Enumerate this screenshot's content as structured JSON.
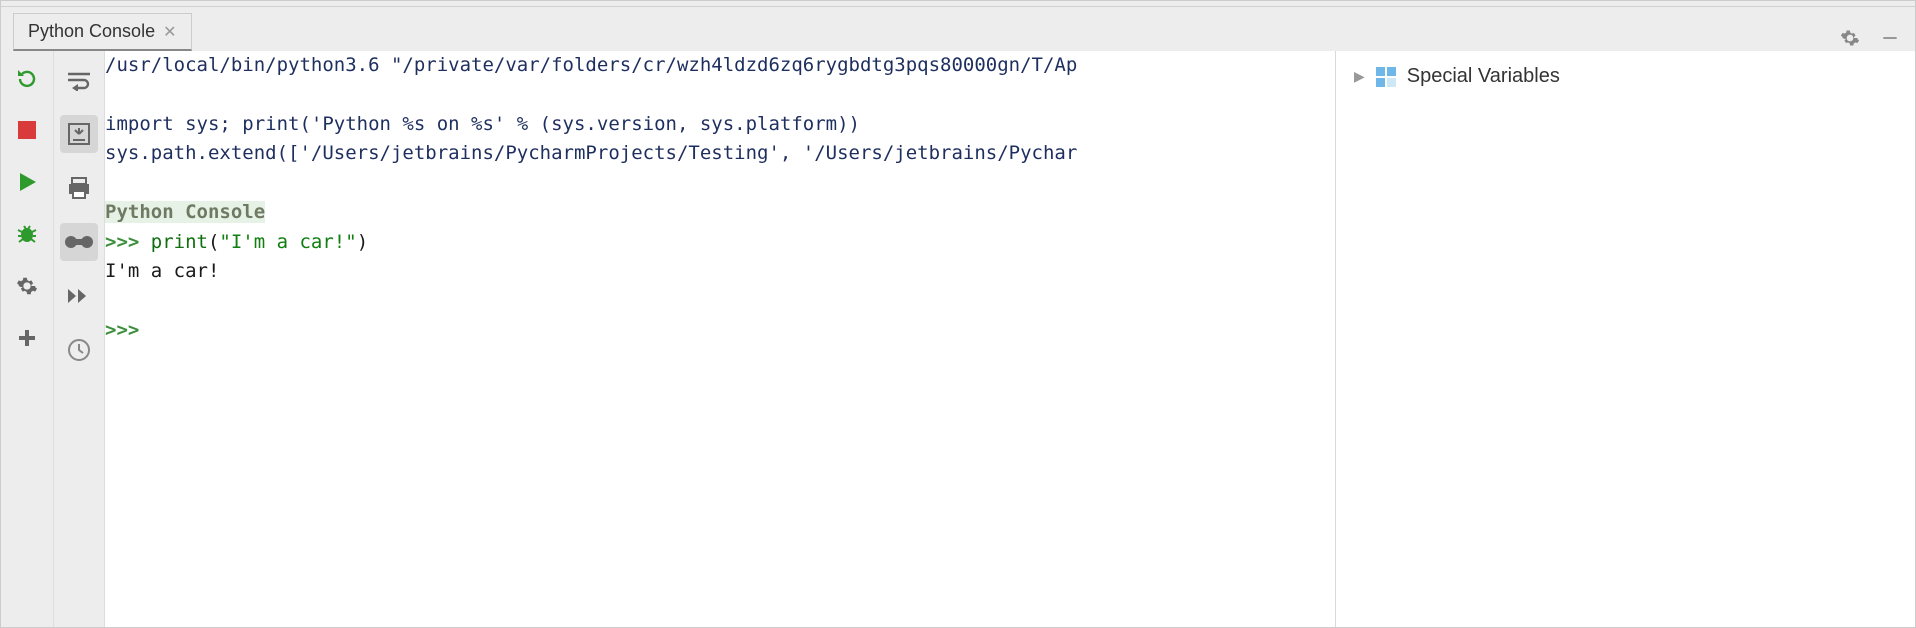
{
  "tab": {
    "title": "Python Console"
  },
  "console": {
    "line_interp": "/usr/local/bin/python3.6 \"/private/var/folders/cr/wzh4ldzd6zq6rygbdtg3pqs80000gn/T/Ap",
    "line_import": "import sys; print('Python %s on %s' % (sys.version, sys.platform))",
    "line_path": "sys.path.extend(['/Users/jetbrains/PycharmProjects/Testing', '/Users/jetbrains/Pychar",
    "banner": "Python Console",
    "prompt1": ">>> ",
    "call_name": "print",
    "call_open": "(",
    "call_str": "\"I'm a car!\"",
    "call_close": ")",
    "output1": "I'm a car!",
    "prompt2": ">>> "
  },
  "vars": {
    "title": "Special Variables"
  },
  "icons": {
    "rerun": "rerun-icon",
    "stop": "stop-icon",
    "run": "run-icon",
    "debug": "debug-icon",
    "settings": "settings-icon",
    "add": "add-icon",
    "softwrap": "soft-wrap-icon",
    "scroll_end": "scroll-to-end-icon",
    "print": "print-icon",
    "show_vars": "show-variables-icon",
    "exec": "execute-icon",
    "history": "history-icon",
    "gear": "gear-icon",
    "minimize": "minimize-icon"
  }
}
